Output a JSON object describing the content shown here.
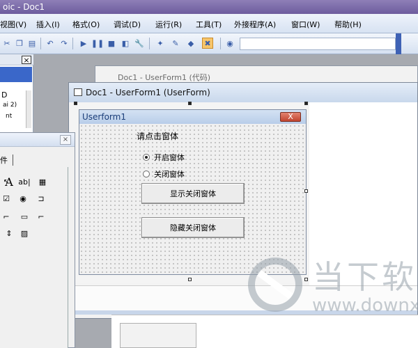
{
  "app": {
    "title_fragment": "oic - Doc1"
  },
  "menu": {
    "items": [
      "视图(V)",
      "插入(I)",
      "格式(O)",
      "调试(D)",
      "运行(R)",
      "工具(T)",
      "外接程序(A)",
      "窗口(W)",
      "帮助(H)"
    ]
  },
  "project_pane": {
    "close": "×",
    "lines": [
      "D",
      "ai 2)",
      "nt"
    ]
  },
  "windows": {
    "back_title": "Doc1 - UserForm1 (代码)",
    "form_title": "Doc1 - UserForm1 (UserForm)"
  },
  "userform": {
    "title": "Userform1",
    "close": "X",
    "label": "请点击窗体",
    "radio_open": "开启窗体",
    "radio_close": "关闭窗体",
    "btn_show": "显示关闭窗体",
    "btn_hide": "隐藏关闭窗体"
  },
  "toolbox": {
    "tab": "件",
    "close": "×"
  },
  "watermark": {
    "text": "当下软",
    "url": "www.downx"
  },
  "colors": {
    "titlebar": "#7d6dae",
    "accent_blue": "#3f62b5",
    "userform_close": "#d15a45"
  }
}
